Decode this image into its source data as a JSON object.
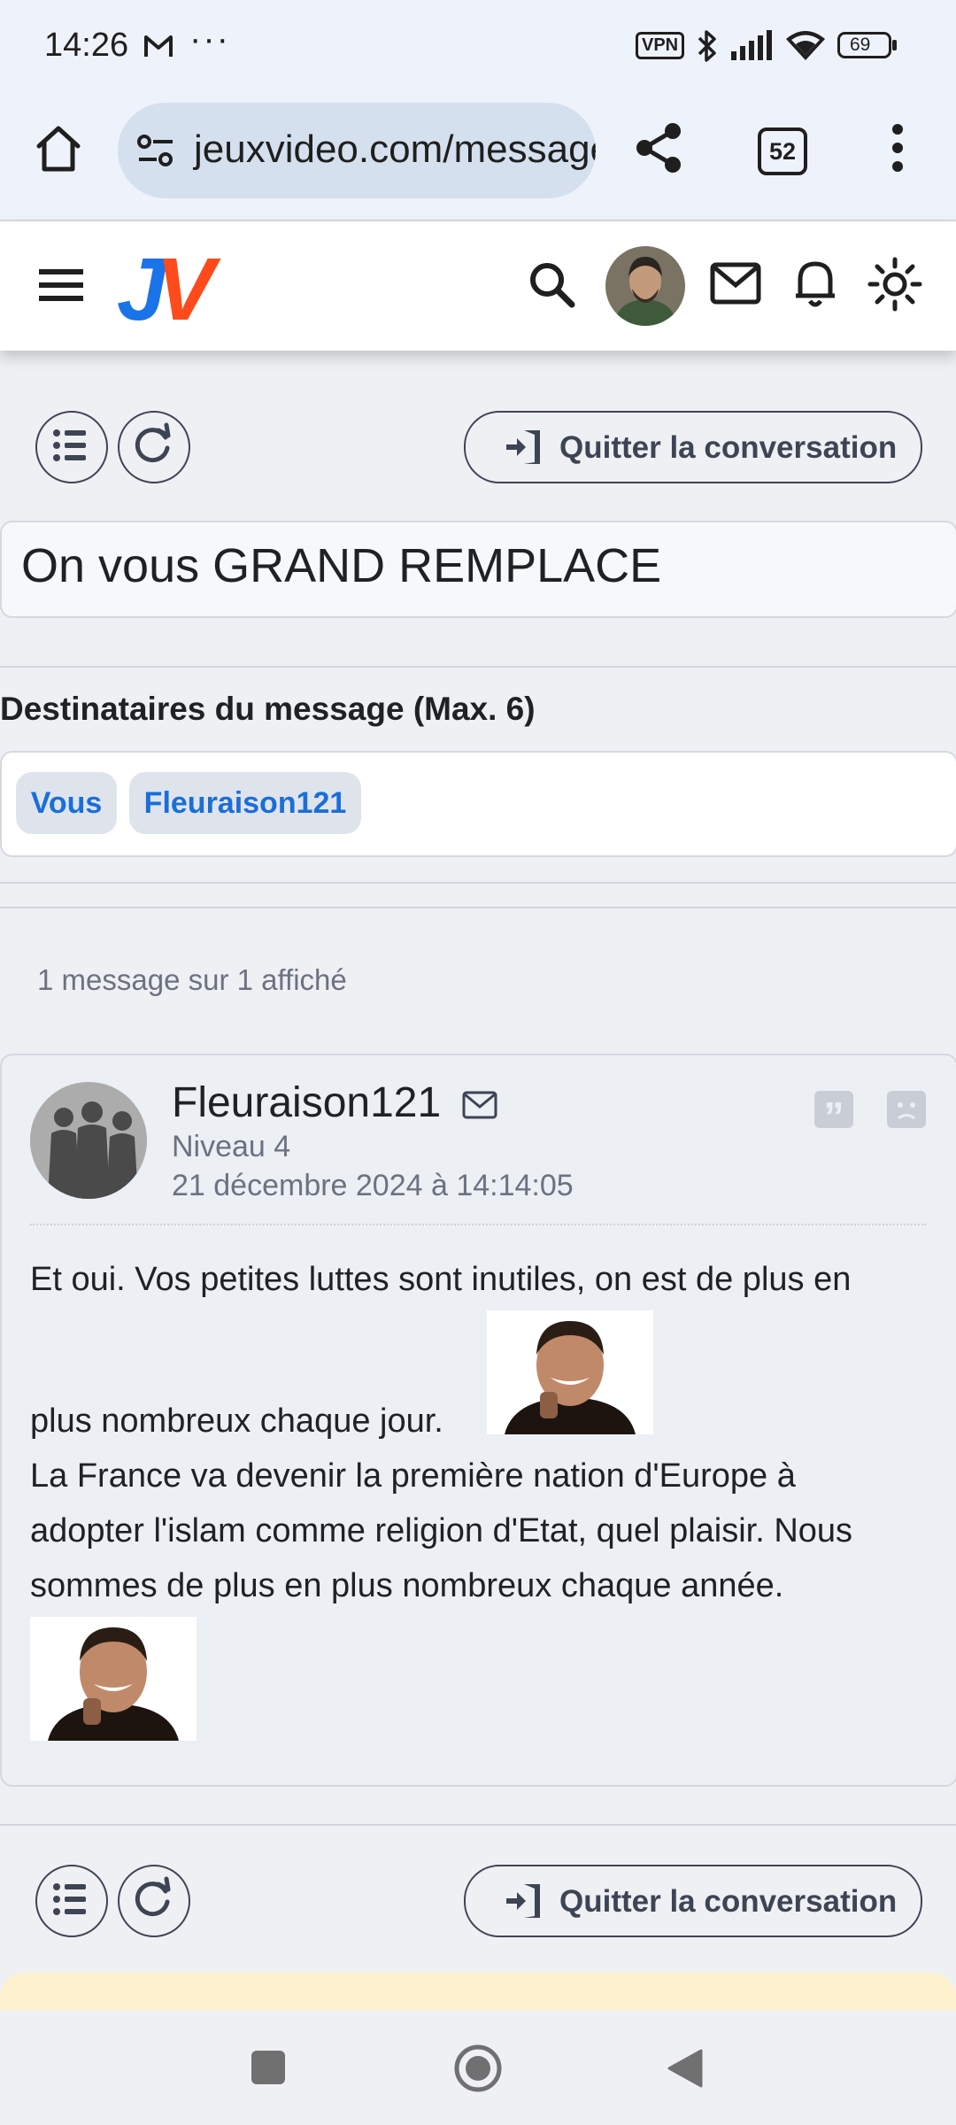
{
  "status_bar": {
    "time": "14:26",
    "more": "···",
    "vpn": "VPN",
    "battery": "69"
  },
  "browser": {
    "url": "jeuxvideo.com/messages-prives/message.php?id=",
    "tab_count": "52"
  },
  "site": {
    "logo_j": "J",
    "logo_v": "V",
    "brand_colors": {
      "j": "#1a73e8",
      "v": "#ff4a1c"
    }
  },
  "controls": {
    "quit_label": "Quitter la conversation"
  },
  "conversation": {
    "title": "On vous GRAND REMPLACE",
    "recipients_label": "Destinataires du message (Max. 6)",
    "recipients": [
      "Vous",
      "Fleuraison121"
    ],
    "message_count": "1 message sur 1 affiché"
  },
  "message": {
    "author": "Fleuraison121",
    "level": "Niveau 4",
    "date": "21 décembre 2024 à 14:14:05",
    "quote_glyph": "”",
    "lines": [
      "Et oui. Vos petites luttes sont inutiles, on est de plus en",
      "plus nombreux chaque jour.",
      "La France va devenir la première nation d'Europe à",
      "adopter l'islam comme religion d'Etat, quel plaisir. Nous",
      "sommes de plus en plus nombreux chaque année."
    ]
  }
}
